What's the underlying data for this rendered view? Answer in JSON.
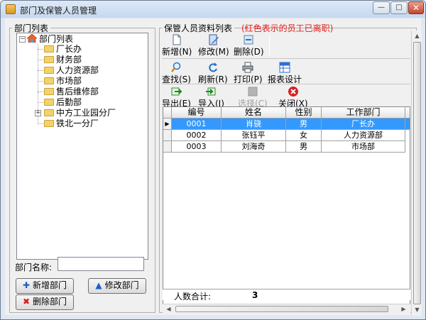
{
  "window": {
    "title": "部门及保管人员管理",
    "min": "—",
    "max": "□",
    "close": "✕"
  },
  "left": {
    "group_title": "部门列表",
    "tree": {
      "root": "部门列表",
      "children": [
        "厂长办",
        "财务部",
        "人力资源部",
        "市场部",
        "售后维修部",
        "后勤部",
        "中方工业园分厂",
        "铁北一分厂"
      ],
      "expanded_marker": "−",
      "collapsed_marker": "+"
    },
    "dept_name_label": "部门名称:",
    "dept_name_value": "",
    "buttons": {
      "add": "新增部门",
      "edit": "修改部门",
      "delete": "删除部门"
    }
  },
  "right": {
    "group_title": "保管人员资料列表",
    "note": "(红色表示的员工已离职)",
    "toolbar1": {
      "new": "新增(N)",
      "edit": "修改(M)",
      "delete": "删除(D)"
    },
    "toolbar2": {
      "find": "查找(S)",
      "refresh": "刷新(R)",
      "print": "打印(P)",
      "report": "报表设计"
    },
    "toolbar3": {
      "export": "导出(E)",
      "import": "导入(I)",
      "select": "选择(C)",
      "close": "关闭(X)"
    },
    "table": {
      "headers": [
        "编号",
        "姓名",
        "性别",
        "工作部门"
      ],
      "rows": [
        [
          "0001",
          "肖骁",
          "男",
          "厂长办"
        ],
        [
          "0002",
          "张钰平",
          "女",
          "人力资源部"
        ],
        [
          "0003",
          "刘海奇",
          "男",
          "市场部"
        ]
      ],
      "row_marker": "▶"
    },
    "footer": {
      "label": "人数合计:",
      "count": "3"
    }
  },
  "colors": {
    "selection": "#3399ff",
    "note": "#e0201c",
    "window_frame": "#dfe8f2"
  }
}
